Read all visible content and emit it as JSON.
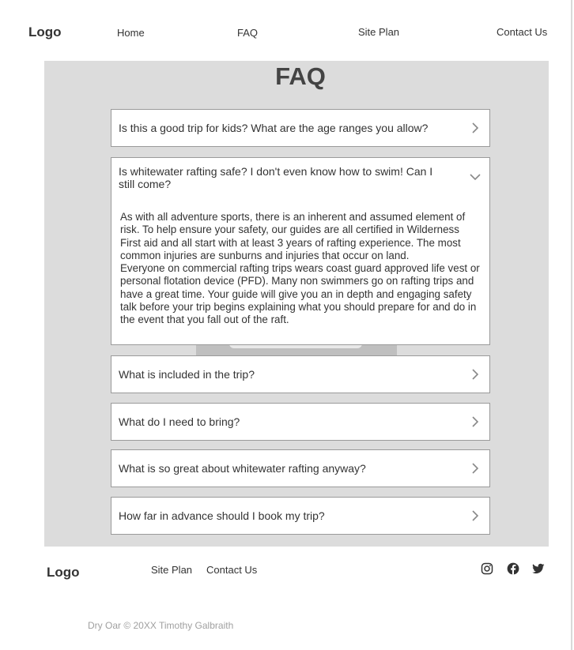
{
  "header": {
    "logo": "Logo",
    "nav": [
      {
        "label": "Home"
      },
      {
        "label": "FAQ"
      },
      {
        "label": "Site Plan"
      },
      {
        "label": "Contact Us"
      }
    ]
  },
  "main": {
    "title": "FAQ",
    "faqs": [
      {
        "question": "Is this a good trip for kids? What are the age ranges you allow?",
        "expanded": false
      },
      {
        "question": "Is whitewater rafting safe? I don't even know how to swim! Can I still come?",
        "expanded": true,
        "answer": [
          "As with all adventure sports, there is an inherent and assumed element of risk. To help ensure your safety, our guides are all certified in Wilderness First aid and all start with at least 3 years of rafting experience. The most common injuries are sunburns and injuries that occur on land.",
          "Everyone on commercial rafting trips wears coast guard approved life vest or personal flotation device (PFD). Many non swimmers go on rafting trips and have a great time. Your guide will give you an in depth and engaging safety talk before your trip begins explaining what you should prepare for and do in the event that you fall out of the raft."
        ]
      },
      {
        "question": "What is included in the trip?",
        "expanded": false
      },
      {
        "question": "What do I need to bring?",
        "expanded": false
      },
      {
        "question": "What is so great about whitewater rafting anyway?",
        "expanded": false
      },
      {
        "question": "How far in advance should I book my trip?",
        "expanded": false
      }
    ]
  },
  "footer": {
    "logo": "Logo",
    "links": [
      {
        "label": "Site Plan"
      },
      {
        "label": "Contact Us"
      }
    ],
    "social_icons": [
      "instagram-icon",
      "facebook-icon",
      "twitter-icon"
    ],
    "copyright": "Dry Oar © 20XX Timothy Galbraith"
  },
  "colors": {
    "main_background": "#dcdcdc",
    "card_background": "#ffffff",
    "card_border": "#9a9a9a",
    "text": "#333333",
    "muted_text": "#a0a0a0"
  }
}
